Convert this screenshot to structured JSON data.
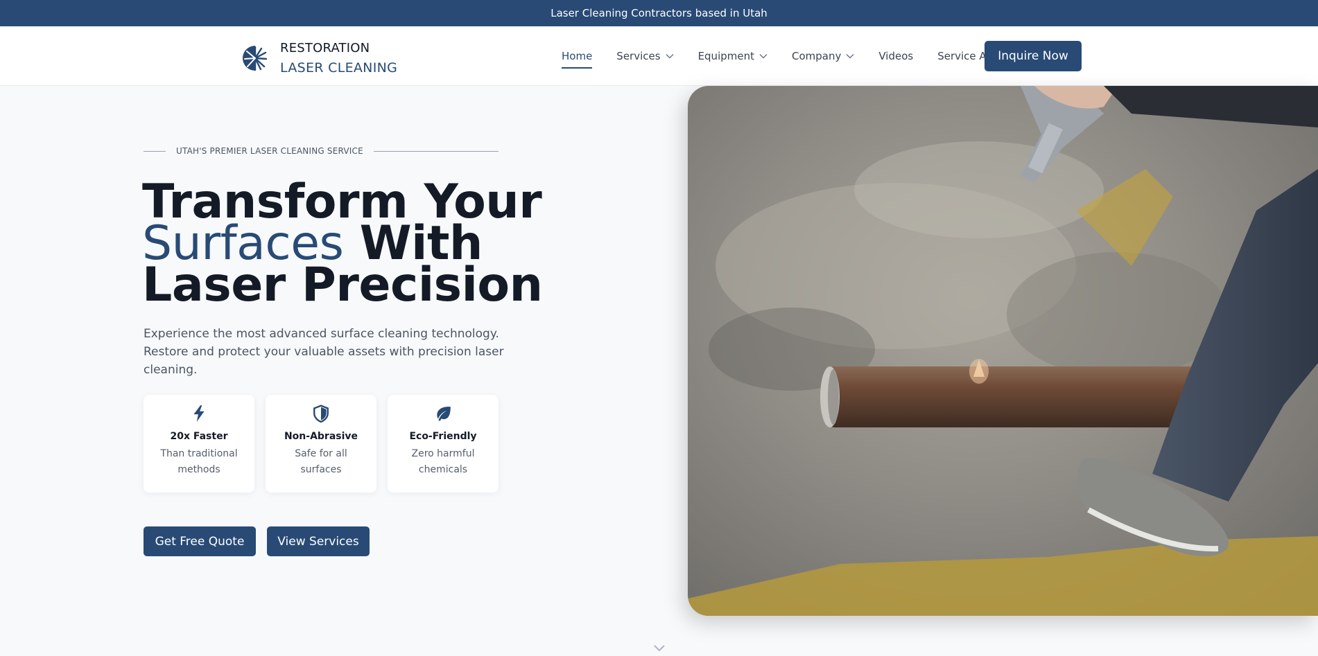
{
  "topbar": {
    "text": "Laser Cleaning Contractors based in Utah"
  },
  "logo": {
    "line1": "RESTORATION",
    "line2": "LASER CLEANING",
    "icon": "starburst-logo"
  },
  "nav": {
    "items": [
      {
        "label": "Home",
        "active": true,
        "dropdown": false
      },
      {
        "label": "Services",
        "active": false,
        "dropdown": true
      },
      {
        "label": "Equipment",
        "active": false,
        "dropdown": true
      },
      {
        "label": "Company",
        "active": false,
        "dropdown": true
      },
      {
        "label": "Videos",
        "active": false,
        "dropdown": false
      },
      {
        "label": "Service Area",
        "active": false,
        "dropdown": false
      }
    ],
    "cta_label": "Inquire Now"
  },
  "hero": {
    "eyebrow": "UTAH'S PREMIER LASER CLEANING SERVICE",
    "title_part1": "Transform Your",
    "title_accent": "Surfaces",
    "title_part2": "With",
    "title_part3": "Laser Precision",
    "subtitle": "Experience the most advanced surface cleaning technology. Restore and protect your valuable assets with precision laser cleaning.",
    "features": [
      {
        "icon": "lightning-icon",
        "title": "20x Faster",
        "desc": "Than traditional methods"
      },
      {
        "icon": "shield-icon",
        "title": "Non-Abrasive",
        "desc": "Safe for all surfaces"
      },
      {
        "icon": "leaf-icon",
        "title": "Eco-Friendly",
        "desc": "Zero harmful chemicals"
      }
    ],
    "buttons": {
      "primary": "Get Free Quote",
      "secondary": "View Services"
    }
  },
  "colors": {
    "brand": "#284a75",
    "text_dark": "#141b26",
    "background": "#f7f9fb"
  }
}
